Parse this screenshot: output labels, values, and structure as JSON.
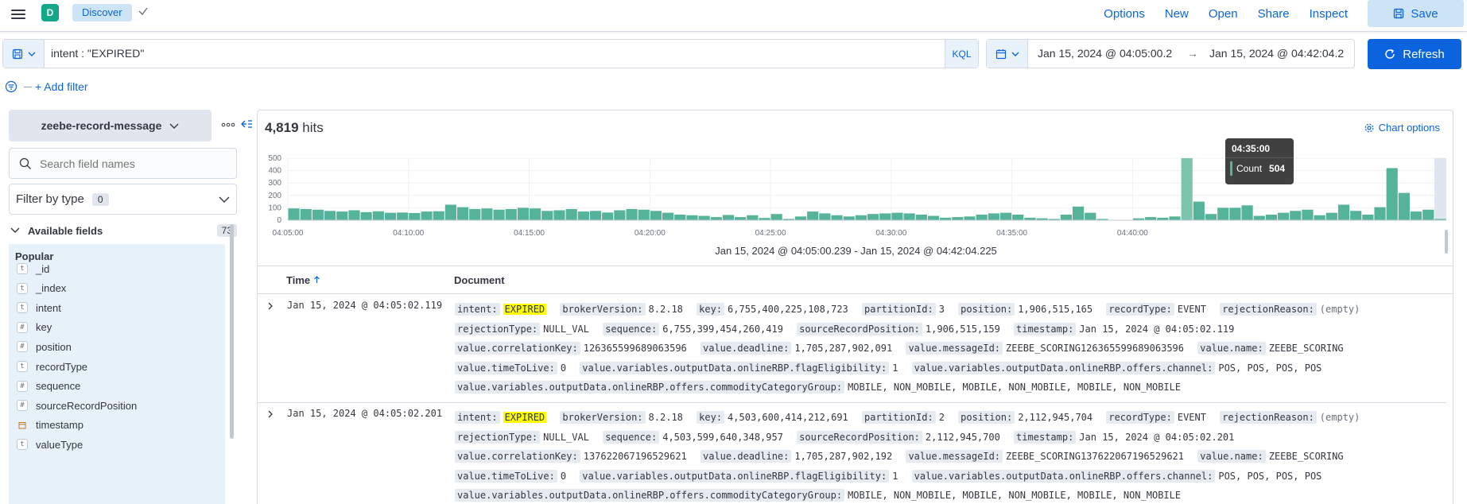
{
  "app": {
    "space_initial": "D",
    "breadcrumb": "Discover"
  },
  "top_nav": [
    "Options",
    "New",
    "Open",
    "Share",
    "Inspect"
  ],
  "save_label": "Save",
  "query": {
    "value": "intent : \"EXPIRED\"",
    "language": "KQL"
  },
  "date": {
    "start": "Jan 15, 2024 @ 04:05:00.2",
    "arrow": "→",
    "end": "Jan 15, 2024 @ 04:42:04.2"
  },
  "refresh_label": "Refresh",
  "add_filter_label": "+ Add filter",
  "sidebar": {
    "index_pattern": "zeebe-record-message",
    "search_placeholder": "Search field names",
    "filter_by_type_label": "Filter by type",
    "filter_by_type_count": "0",
    "available_fields_label": "Available fields",
    "available_fields_count": "73",
    "popular_label": "Popular",
    "fields": [
      {
        "type": "t",
        "name": "_id"
      },
      {
        "type": "t",
        "name": "_index"
      },
      {
        "type": "t",
        "name": "intent"
      },
      {
        "type": "#",
        "name": "key"
      },
      {
        "type": "#",
        "name": "position"
      },
      {
        "type": "t",
        "name": "recordType"
      },
      {
        "type": "#",
        "name": "sequence"
      },
      {
        "type": "#",
        "name": "sourceRecordPosition"
      },
      {
        "type": "date",
        "name": "timestamp"
      },
      {
        "type": "t",
        "name": "valueType"
      }
    ]
  },
  "main": {
    "hits_count": "4,819",
    "hits_label": "hits",
    "chart_options_label": "Chart options",
    "range_label": "Jan 15, 2024 @ 04:05:00.239 - Jan 15, 2024 @ 04:42:04.225",
    "tooltip": {
      "time": "04:35:00",
      "label": "Count",
      "value": "504"
    }
  },
  "chart_data": {
    "type": "bar",
    "title": "",
    "xlabel": "",
    "ylabel": "",
    "ylim": [
      0,
      500
    ],
    "yticks": [
      "500",
      "400",
      "300",
      "200",
      "100",
      "0"
    ],
    "xticks": [
      "04:05:00",
      "04:10:00",
      "04:15:00",
      "04:20:00",
      "04:25:00",
      "04:30:00",
      "04:35:00",
      "04:40:00"
    ],
    "interval_seconds": 30,
    "grid": true,
    "legend": "none",
    "bar_color": "#54b399",
    "values": [
      95,
      90,
      85,
      75,
      70,
      80,
      65,
      72,
      60,
      62,
      58,
      70,
      72,
      125,
      105,
      90,
      95,
      85,
      90,
      100,
      95,
      75,
      80,
      90,
      70,
      75,
      62,
      80,
      90,
      85,
      75,
      60,
      45,
      40,
      35,
      25,
      42,
      25,
      40,
      18,
      50,
      10,
      30,
      70,
      55,
      40,
      30,
      40,
      50,
      55,
      60,
      55,
      45,
      35,
      20,
      25,
      30,
      45,
      55,
      60,
      45,
      20,
      15,
      10,
      45,
      110,
      60,
      10,
      0,
      0,
      15,
      25,
      20,
      30,
      504,
      150,
      50,
      100,
      100,
      120,
      35,
      45,
      60,
      75,
      85,
      40,
      60,
      125,
      75,
      45,
      105,
      420,
      220,
      70,
      85,
      10
    ]
  },
  "table": {
    "time_header": "Time",
    "document_header": "Document",
    "rows": [
      {
        "time": "Jan 15, 2024 @ 04:05:02.119",
        "fields": [
          {
            "k": "intent:",
            "v": "EXPIRED",
            "hl": true
          },
          {
            "k": "brokerVersion:",
            "v": "8.2.18"
          },
          {
            "k": "key:",
            "v": "6,755,400,225,108,723"
          },
          {
            "k": "partitionId:",
            "v": "3"
          },
          {
            "k": "position:",
            "v": "1,906,515,165"
          },
          {
            "k": "recordType:",
            "v": "EVENT"
          },
          {
            "k": "rejectionReason:",
            "v": "(empty)",
            "empty": true
          },
          {
            "k": "rejectionType:",
            "v": "NULL_VAL"
          },
          {
            "k": "sequence:",
            "v": "6,755,399,454,260,419"
          },
          {
            "k": "sourceRecordPosition:",
            "v": "1,906,515,159"
          },
          {
            "k": "timestamp:",
            "v": "Jan 15, 2024 @ 04:05:02.119"
          },
          {
            "k": "value.correlationKey:",
            "v": "126365599689063596"
          },
          {
            "k": "value.deadline:",
            "v": "1,705,287,902,091"
          },
          {
            "k": "value.messageId:",
            "v": "ZEEBE_SCORING126365599689063596"
          },
          {
            "k": "value.name:",
            "v": "ZEEBE_SCORING"
          },
          {
            "k": "value.timeToLive:",
            "v": "0"
          },
          {
            "k": "value.variables.outputData.onlineRBP.flagEligibility:",
            "v": "1"
          },
          {
            "k": "value.variables.outputData.onlineRBP.offers.channel:",
            "v": "POS, POS, POS, POS"
          },
          {
            "k": "value.variables.outputData.onlineRBP.offers.commodityCategoryGroup:",
            "v": "MOBILE, NON_MOBILE, MOBILE, NON_MOBILE, MOBILE, NON_MOBILE"
          }
        ]
      },
      {
        "time": "Jan 15, 2024 @ 04:05:02.201",
        "fields": [
          {
            "k": "intent:",
            "v": "EXPIRED",
            "hl": true
          },
          {
            "k": "brokerVersion:",
            "v": "8.2.18"
          },
          {
            "k": "key:",
            "v": "4,503,600,414,212,691"
          },
          {
            "k": "partitionId:",
            "v": "2"
          },
          {
            "k": "position:",
            "v": "2,112,945,704"
          },
          {
            "k": "recordType:",
            "v": "EVENT"
          },
          {
            "k": "rejectionReason:",
            "v": "(empty)",
            "empty": true
          },
          {
            "k": "rejectionType:",
            "v": "NULL_VAL"
          },
          {
            "k": "sequence:",
            "v": "4,503,599,640,348,957"
          },
          {
            "k": "sourceRecordPosition:",
            "v": "2,112,945,700"
          },
          {
            "k": "timestamp:",
            "v": "Jan 15, 2024 @ 04:05:02.201"
          },
          {
            "k": "value.correlationKey:",
            "v": "137622067196529621"
          },
          {
            "k": "value.deadline:",
            "v": "1,705,287,902,192"
          },
          {
            "k": "value.messageId:",
            "v": "ZEEBE_SCORING137622067196529621"
          },
          {
            "k": "value.name:",
            "v": "ZEEBE_SCORING"
          },
          {
            "k": "value.timeToLive:",
            "v": "0"
          },
          {
            "k": "value.variables.outputData.onlineRBP.flagEligibility:",
            "v": "1"
          },
          {
            "k": "value.variables.outputData.onlineRBP.offers.channel:",
            "v": "POS, POS, POS, POS"
          },
          {
            "k": "value.variables.outputData.onlineRBP.offers.commodityCategoryGroup:",
            "v": "MOBILE, NON_MOBILE, MOBILE, NON_MOBILE, MOBILE, NON_MOBILE"
          }
        ]
      }
    ]
  },
  "colors": {
    "accent": "#0b64dd",
    "accent_light": "#cce4f5",
    "bar": "#54b399",
    "highlight": "#fdff00"
  }
}
